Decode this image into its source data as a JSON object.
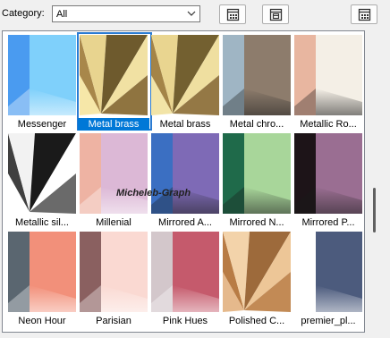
{
  "toolbar": {
    "category_label": "Category:",
    "category_value": "All",
    "button1_icon": "grid-icon",
    "button2_icon": "import-icon",
    "button3_icon": "grid-icon"
  },
  "watermark": "Micheleb-Graph",
  "selected_index": 1,
  "tiles": [
    {
      "label": "Messenger",
      "kind": "split",
      "left": "#4a9bf0",
      "right": "#7fd0fb"
    },
    {
      "label": "Metal brass",
      "kind": "cone",
      "colors": [
        "#f6e7a8",
        "#a8874a",
        "#e8d48f",
        "#6e5a2d",
        "#f1e1a3",
        "#8f7440"
      ]
    },
    {
      "label": "Metal brass",
      "kind": "cone",
      "colors": [
        "#f2e4a7",
        "#a48447",
        "#e9d590",
        "#736030",
        "#efdfa0",
        "#947845"
      ]
    },
    {
      "label": "Metal chro...",
      "kind": "split",
      "left": "#9fb5c4",
      "right": "#8d7c6c",
      "dark": true
    },
    {
      "label": "Metallic Ro...",
      "kind": "split",
      "left": "#e8b6a0",
      "right": "#f4efe6",
      "dark": true
    },
    {
      "label": "Metallic sil...",
      "kind": "cone",
      "colors": [
        "#ffffff",
        "#404040",
        "#f2f2f2",
        "#1a1a1a",
        "#ffffff",
        "#6a6a6a"
      ]
    },
    {
      "label": "Millenial",
      "kind": "split",
      "left": "#eeb3a3",
      "right": "#dcb8d6"
    },
    {
      "label": "Mirrored A...",
      "kind": "split",
      "left": "#3b6fc2",
      "right": "#7e6ab6",
      "dark": true
    },
    {
      "label": "Mirrored N...",
      "kind": "split",
      "left": "#1f6a4a",
      "right": "#a8d69a",
      "dark": true
    },
    {
      "label": "Mirrored P...",
      "kind": "split",
      "left": "#1d1418",
      "right": "#9a6e92",
      "dark": true
    },
    {
      "label": "Neon Hour",
      "kind": "split",
      "left": "#5a6670",
      "right": "#f2907a"
    },
    {
      "label": "Parisian",
      "kind": "split",
      "left": "#8a6060",
      "right": "#fad9d2"
    },
    {
      "label": "Pink Hues",
      "kind": "split",
      "left": "#d3c7cb",
      "right": "#c55a6c"
    },
    {
      "label": "Polished C...",
      "kind": "cone",
      "colors": [
        "#e5b98c",
        "#b87c45",
        "#f3d3aa",
        "#9d6a3b",
        "#edc697",
        "#c28a55"
      ]
    },
    {
      "label": "premier_pl...",
      "kind": "split",
      "left": "#ffffff",
      "right": "#4c5b7d"
    }
  ]
}
